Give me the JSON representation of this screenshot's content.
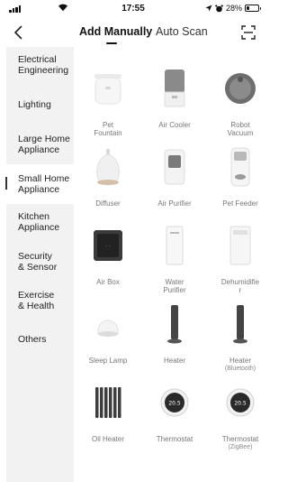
{
  "status_bar": {
    "time": "17:55",
    "battery": "28%",
    "battery_level": 0.28
  },
  "nav": {
    "back_icon": "chevron-left-icon",
    "tabs": [
      {
        "label": "Add Manually",
        "active": true
      },
      {
        "label": "Auto Scan",
        "active": false
      }
    ],
    "scan_icon": "scan-frame-icon"
  },
  "sidebar": {
    "items": [
      {
        "label_lines": [
          "Electrical",
          "Engineering"
        ]
      },
      {
        "label_lines": [
          "Lighting"
        ]
      },
      {
        "label_lines": [
          "Large Home",
          "Appliance"
        ]
      },
      {
        "label_lines": [
          "Small Home",
          "Appliance"
        ],
        "active": true
      },
      {
        "label_lines": [
          "Kitchen",
          "Appliance"
        ]
      },
      {
        "label_lines": [
          "Security",
          "& Sensor"
        ]
      },
      {
        "label_lines": [
          "Exercise",
          "& Health"
        ]
      },
      {
        "label_lines": [
          "Others"
        ]
      }
    ]
  },
  "devices": [
    {
      "name_lines": [
        "Pet",
        "Fountain"
      ],
      "icon": "pet-fountain-icon"
    },
    {
      "name_lines": [
        "Air Cooler"
      ],
      "icon": "air-cooler-icon"
    },
    {
      "name_lines": [
        "Robot",
        "Vacuum"
      ],
      "icon": "robot-vacuum-icon"
    },
    {
      "name_lines": [
        "Diffuser"
      ],
      "icon": "diffuser-icon"
    },
    {
      "name_lines": [
        "Air Purifier"
      ],
      "icon": "air-purifier-icon"
    },
    {
      "name_lines": [
        "Pet Feeder"
      ],
      "icon": "pet-feeder-icon"
    },
    {
      "name_lines": [
        "Air Box"
      ],
      "icon": "air-box-icon"
    },
    {
      "name_lines": [
        "Water",
        "Purifier"
      ],
      "icon": "water-purifier-icon"
    },
    {
      "name_lines": [
        "Dehumidifie",
        "r"
      ],
      "icon": "dehumidifier-icon"
    },
    {
      "name_lines": [
        "Sleep Lamp"
      ],
      "icon": "sleep-lamp-icon"
    },
    {
      "name_lines": [
        "Heater"
      ],
      "icon": "heater-icon"
    },
    {
      "name_lines": [
        "Heater"
      ],
      "sub": "(Bluetooth)",
      "icon": "heater-bluetooth-icon"
    },
    {
      "name_lines": [
        "Oil Heater"
      ],
      "icon": "oil-heater-icon"
    },
    {
      "name_lines": [
        "Thermostat"
      ],
      "icon": "thermostat-icon",
      "display": "20.5"
    },
    {
      "name_lines": [
        "Thermostat"
      ],
      "sub": "(ZigBee)",
      "icon": "thermostat-zigbee-icon",
      "display": "20.5"
    }
  ]
}
